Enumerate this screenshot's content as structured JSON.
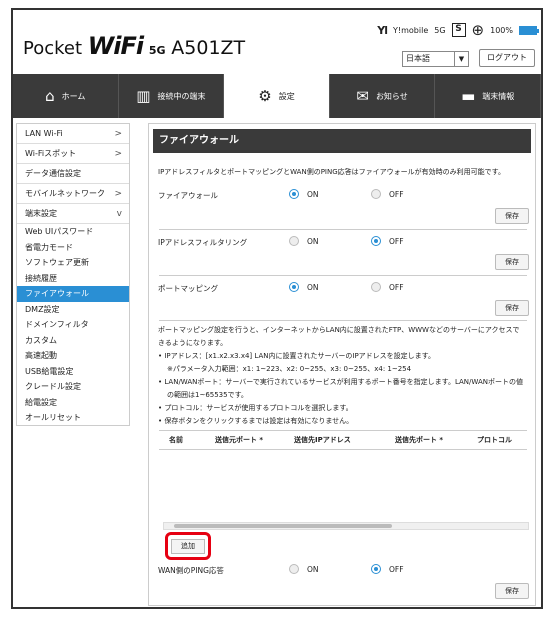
{
  "header": {
    "logo_prefix": "Pocket",
    "logo_wifi": "WiFi",
    "logo_5g": "5G",
    "logo_model": "A501ZT",
    "signal": "Yl",
    "carrier": "Y!mobile",
    "network": "5G",
    "sim_badge": "S",
    "battery": "100%",
    "language": "日本語",
    "logout": "ログアウト"
  },
  "nav": [
    {
      "label": "ホーム",
      "icon": "home-icon"
    },
    {
      "label": "接続中の端末",
      "icon": "devices-icon"
    },
    {
      "label": "設定",
      "icon": "gear-icon"
    },
    {
      "label": "お知らせ",
      "icon": "mail-icon"
    },
    {
      "label": "端末情報",
      "icon": "device-info-icon"
    }
  ],
  "sidebar": {
    "items": [
      {
        "label": "LAN Wi-Fi",
        "chev": ">"
      },
      {
        "label": "Wi-Fiスポット",
        "chev": ">"
      },
      {
        "label": "データ通信設定",
        "chev": ""
      },
      {
        "label": "モバイルネットワーク",
        "chev": ">"
      },
      {
        "label": "端末設定",
        "chev": "v"
      }
    ],
    "subitems": [
      "Web UIパスワード",
      "省電力モード",
      "ソフトウェア更新",
      "接続履歴",
      "ファイアウォール",
      "DMZ設定",
      "ドメインフィルタ",
      "カスタム",
      "高速起動",
      "USB給電設定",
      "クレードル設定",
      "給電設定",
      "オールリセット"
    ]
  },
  "main": {
    "title": "ファイアウォール",
    "intro": "IPアドレスフィルタとポートマッピングとWAN側のPING応答はファイアウォールが有効時のみ利用可能です。",
    "firewall_label": "ファイアウォール",
    "ipfilter_label": "IPアドレスフィルタリング",
    "portmap_label": "ポートマッピング",
    "on": "ON",
    "off": "OFF",
    "save": "保存",
    "desc1": "ポートマッピング設定を行うと、インターネットからLAN内に設置されたFTP、WWWなどのサーバーにアクセスで",
    "desc2": "きるようになります。",
    "bullet1": "•  IPアドレス：[x1.x2.x3.x4] LAN内に設置されたサーバーのIPアドレスを設定します。",
    "bullet1b": "※パラメータ入力範囲：x1: 1~223、x2: 0~255、x3: 0~255、x4: 1~254",
    "bullet2": "•  LAN/WANポート：サーバーで実行されているサービスが利用するポート番号を指定します。LAN/WANポートの値",
    "bullet2b": "の範囲は1~65535です。",
    "bullet3": "•  プロトコル：サービスが使用するプロトコルを選択します。",
    "bullet4": "•  保存ボタンをクリックするまでは設定は有効になりません。",
    "columns": [
      "名前",
      "送信元ポート *",
      "送信先IPアドレス",
      "送信先ポート *",
      "プロトコル"
    ],
    "add": "追加",
    "wanping_label": "WAN側のPING応答"
  }
}
